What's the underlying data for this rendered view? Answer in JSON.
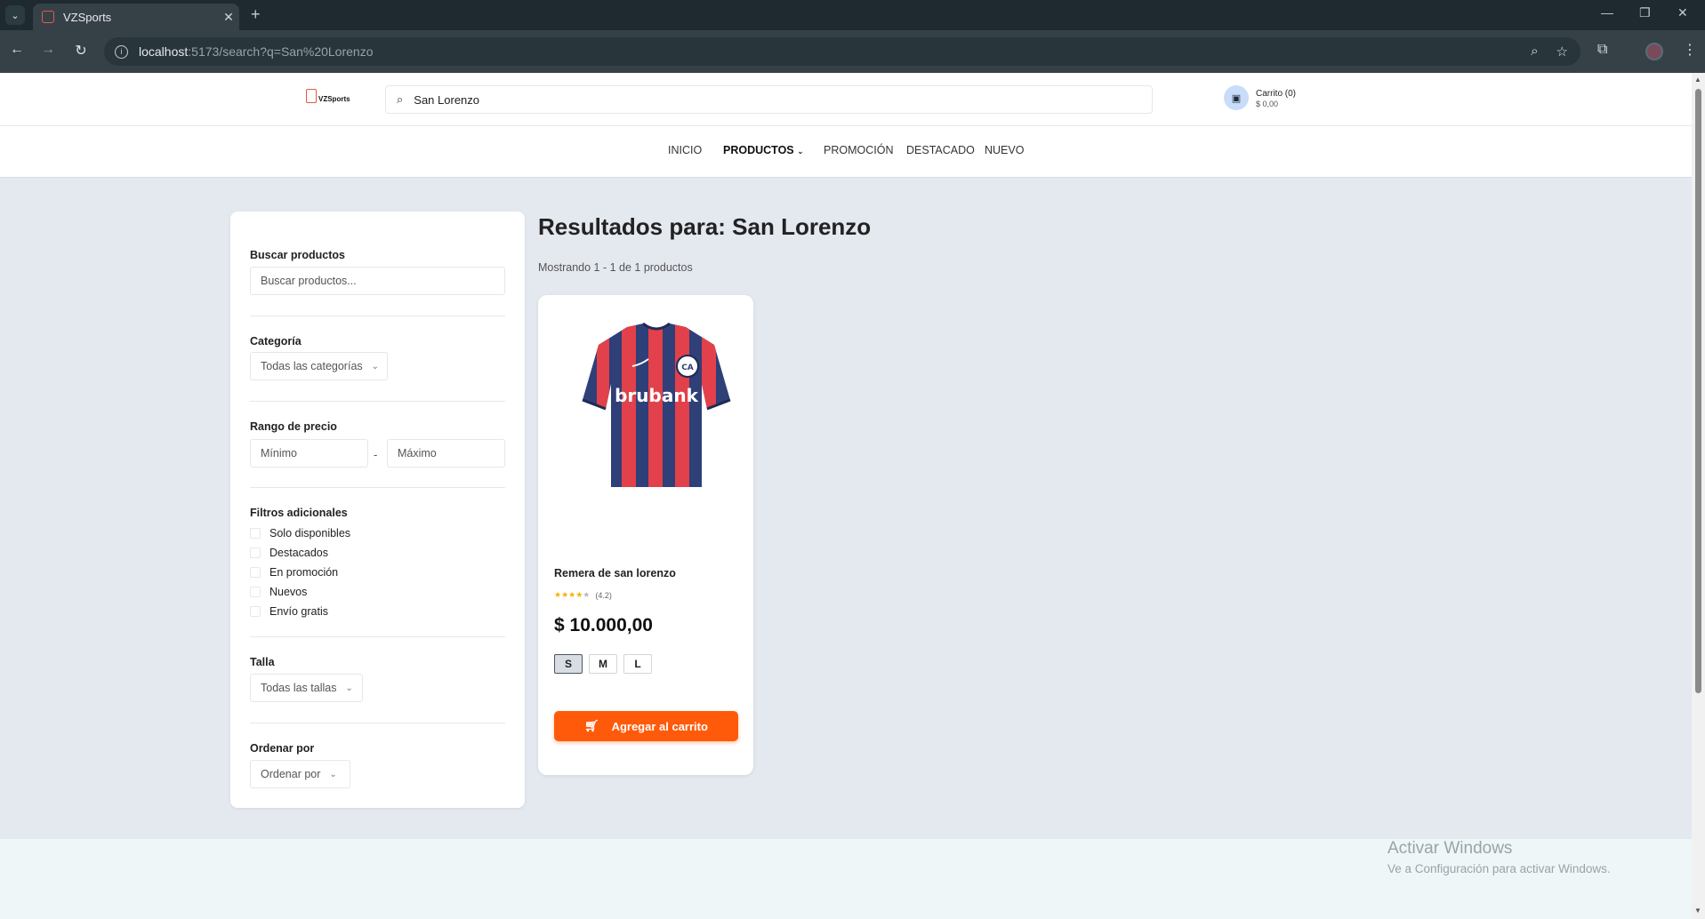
{
  "browser": {
    "tab_title": "VZSports",
    "tab_close": "✕",
    "new_tab": "+",
    "url_host": "localhost",
    "url_rest": ":5173/search?q=San%20Lorenzo",
    "icons": [
      "back-icon",
      "forward-icon",
      "reload-icon",
      "info-icon",
      "zoom-icon",
      "star-icon",
      "extensions-icon",
      "profile-icon",
      "kebab-icon"
    ]
  },
  "header": {
    "logo_text": "VZSports",
    "search_value": "San Lorenzo",
    "cart_label": "Carrito (0)",
    "cart_total": "$ 0,00"
  },
  "nav": {
    "items": [
      "INICIO",
      "PRODUCTOS",
      "PROMOCIÓN",
      "DESTACADO",
      "NUEVO"
    ]
  },
  "sidebar": {
    "search_label": "Buscar productos",
    "search_placeholder": "Buscar productos...",
    "category_label": "Categoría",
    "category_value": "Todas las categorías",
    "price_label": "Rango de precio",
    "price_min_placeholder": "Mínimo",
    "price_separator": "-",
    "price_max_placeholder": "Máximo",
    "filters_label": "Filtros adicionales",
    "filters": [
      "Solo disponibles",
      "Destacados",
      "En promoción",
      "Nuevos",
      "Envío gratis"
    ],
    "size_label": "Talla",
    "size_value": "Todas las tallas",
    "sort_label": "Ordenar por",
    "sort_value": "Ordenar por"
  },
  "results": {
    "title": "Resultados para: San Lorenzo",
    "count": "Mostrando 1 - 1 de 1 productos"
  },
  "product": {
    "name": "Remera de san lorenzo",
    "rating": 4.2,
    "rating_text": "(4.2)",
    "price": "$ 10.000,00",
    "sizes": [
      "S",
      "M",
      "L"
    ],
    "selected_size": "S",
    "add_button": "Agregar al carrito",
    "jersey_sponsor": "brubank",
    "colors": {
      "blue": "#2f3f78",
      "red": "#e2404a"
    }
  },
  "watermark": {
    "title": "Activar Windows",
    "subtitle": "Ve a Configuración para activar Windows."
  },
  "colors": {
    "accent": "#ff5a0a",
    "page_bg": "#e4e8ef"
  }
}
